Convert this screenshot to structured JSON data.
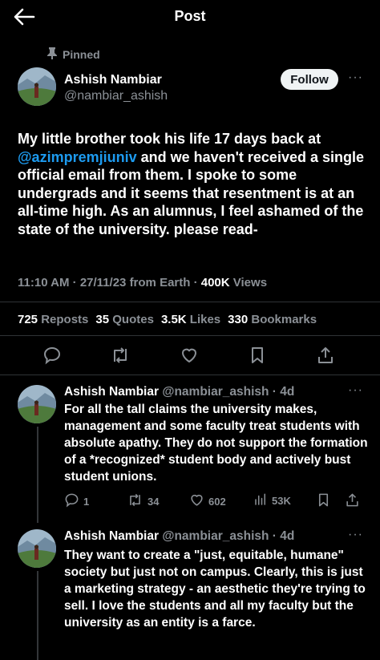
{
  "header": {
    "title": "Post"
  },
  "pinned_label": "Pinned",
  "author": {
    "name": "Ashish Nambiar",
    "handle": "@nambiar_ashish"
  },
  "follow_label": "Follow",
  "post": {
    "text_before": "My little brother took his life 17 days back at ",
    "mention": "@azimpremjiuniv",
    "text_after": " and we haven't received a single official email from them. I spoke to some undergrads and it seems that resentment is at an all-time high. As an alumnus, I feel ashamed of the state of the university.  please read-",
    "time": "11:10 AM",
    "date": "27/11/23",
    "source": "from Earth",
    "views_count": "400K",
    "views_label": "Views"
  },
  "stats": [
    {
      "count": "725",
      "label": "Reposts"
    },
    {
      "count": "35",
      "label": "Quotes"
    },
    {
      "count": "3.5K",
      "label": "Likes"
    },
    {
      "count": "330",
      "label": "Bookmarks"
    }
  ],
  "replies": [
    {
      "name": "Ashish Nambiar",
      "handle": "@nambiar_ashish",
      "age": "4d",
      "text": "For all the tall claims the university makes, management and some faculty treat students with absolute apathy. They do not support the formation of a *recognized* student body and actively bust student unions.",
      "reply_count": "1",
      "repost_count": "34",
      "like_count": "602",
      "view_count": "53K"
    },
    {
      "name": "Ashish Nambiar",
      "handle": "@nambiar_ashish",
      "age": "4d",
      "text": "They want to create a \"just, equitable, humane\" society but just not on campus. Clearly, this is just a marketing strategy - an aesthetic they're trying to sell. I love the students and all my faculty but the university as an entity is a farce."
    }
  ],
  "colors": {
    "accent": "#1d9bf0",
    "muted": "#8b9096",
    "background": "#000000"
  }
}
